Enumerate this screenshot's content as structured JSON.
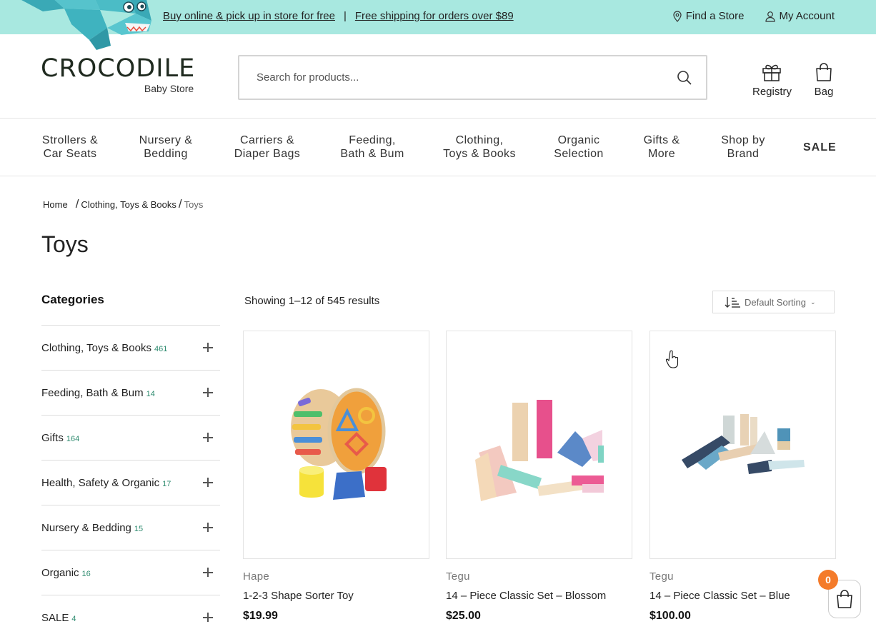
{
  "topbar": {
    "promo_pickup": "Buy online & pick up in store for free",
    "separator": "|",
    "promo_shipping": "Free shipping for orders over $89",
    "find_store": "Find a Store",
    "my_account": "My Account"
  },
  "logo": {
    "name": "CROCODILE",
    "sub": "Baby Store"
  },
  "search": {
    "placeholder": "Search for products..."
  },
  "header_icons": {
    "registry": "Registry",
    "bag": "Bag"
  },
  "nav": [
    {
      "line1": "Strollers &",
      "line2": "Car Seats"
    },
    {
      "line1": "Nursery &",
      "line2": "Bedding"
    },
    {
      "line1": "Carriers &",
      "line2": "Diaper Bags"
    },
    {
      "line1": "Feeding,",
      "line2": "Bath & Bum"
    },
    {
      "line1": "Clothing,",
      "line2": "Toys & Books"
    },
    {
      "line1": "Organic",
      "line2": "Selection"
    },
    {
      "line1": "Gifts &",
      "line2": "More"
    },
    {
      "line1": "Shop by",
      "line2": "Brand"
    },
    {
      "line1": "SALE",
      "line2": ""
    }
  ],
  "breadcrumb": {
    "home": "Home",
    "sep": "/",
    "parent": "Clothing, Toys & Books",
    "current": "Toys"
  },
  "page_title": "Toys",
  "sidebar": {
    "title": "Categories",
    "items": [
      {
        "label": "Clothing, Toys & Books",
        "count": "461"
      },
      {
        "label": "Feeding, Bath & Bum",
        "count": "14"
      },
      {
        "label": "Gifts",
        "count": "164"
      },
      {
        "label": "Health, Safety & Organic",
        "count": "17"
      },
      {
        "label": "Nursery & Bedding",
        "count": "15"
      },
      {
        "label": "Organic",
        "count": "16"
      },
      {
        "label": "SALE",
        "count": "4"
      }
    ]
  },
  "results": {
    "text": "Showing 1–12 of 545 results",
    "sorting": "Default Sorting"
  },
  "products": [
    {
      "brand": "Hape",
      "title": "1-2-3 Shape Sorter Toy",
      "price": "$19.99"
    },
    {
      "brand": "Tegu",
      "title": "14 – Piece Classic Set – Blossom",
      "price": "$25.00"
    },
    {
      "brand": "Tegu",
      "title": "14 – Piece Classic Set – Blue",
      "price": "$100.00"
    }
  ],
  "cart": {
    "count": "0"
  },
  "colors": {
    "topbar_bg": "#a8e8e0",
    "count_green": "#2e8b6f",
    "badge_orange": "#f47b2a"
  }
}
